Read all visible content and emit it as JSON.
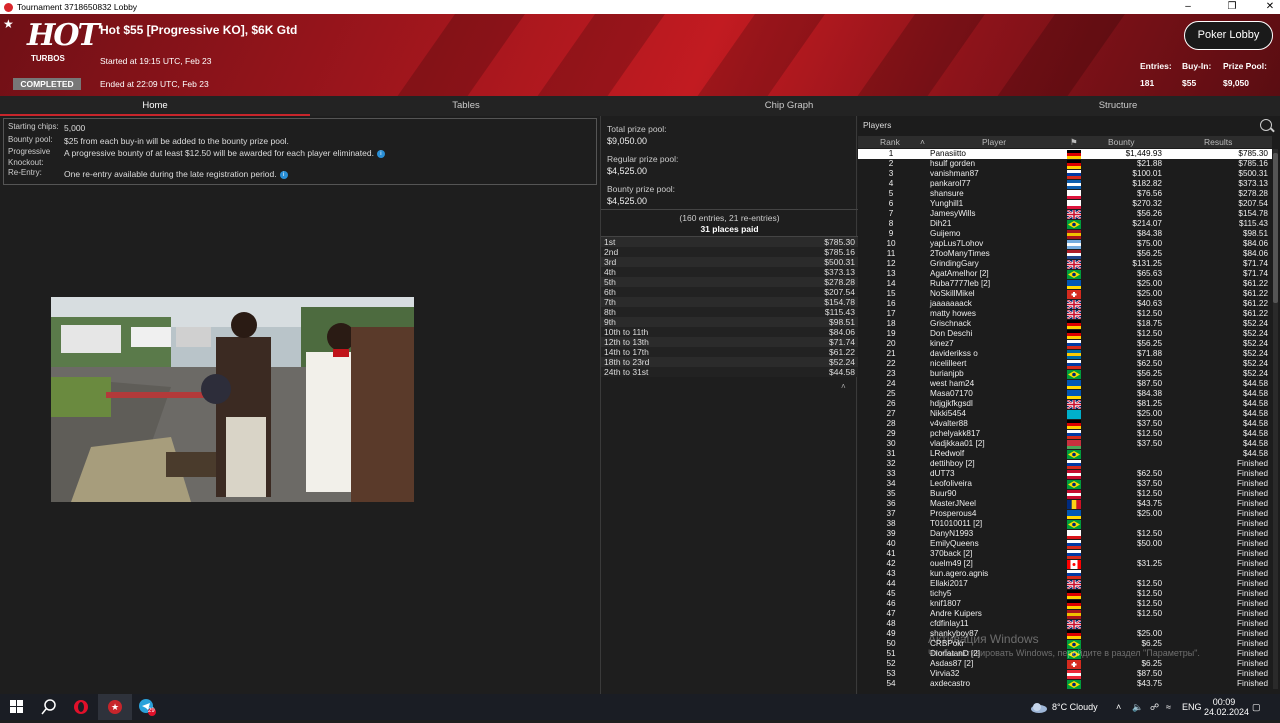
{
  "window": {
    "title": "Tournament 3718650832 Lobby"
  },
  "header": {
    "logo_text": "HOT TURBOS",
    "status_badge": "COMPLETED",
    "tournament_name": "Hot $55 [Progressive KO], $6K Gtd",
    "started": "Started at 19:15 UTC, Feb 23",
    "ended": "Ended at 22:09 UTC, Feb 23",
    "poker_lobby_button": "Poker Lobby",
    "entries_label": "Entries:",
    "entries_value": "181",
    "buyin_label": "Buy-In:",
    "buyin_value": "$55",
    "prizepool_label": "Prize Pool:",
    "prizepool_value": "$9,050"
  },
  "tabs": [
    "Home",
    "Tables",
    "Chip Graph",
    "Structure"
  ],
  "info": [
    {
      "k": "Starting chips:",
      "v": "5,000"
    },
    {
      "k": "Bounty pool:",
      "v": "$25 from each buy-in will be added to the bounty prize pool."
    },
    {
      "k": "Progressive Knockout:",
      "v": "A progressive bounty of at least $12.50 will be awarded for each player eliminated."
    },
    {
      "k": "Re-Entry:",
      "v": "One re-entry available during the late registration period."
    }
  ],
  "prize": {
    "total_label": "Total prize pool:",
    "total_value": "$9,050.00",
    "regular_label": "Regular prize pool:",
    "regular_value": "$4,525.00",
    "bounty_label": "Bounty prize pool:",
    "bounty_value": "$4,525.00",
    "entries_line": "(160 entries, 21 re-entries)",
    "places_paid": "31 places paid",
    "payouts": [
      [
        "1st",
        "$785.30"
      ],
      [
        "2nd",
        "$785.16"
      ],
      [
        "3rd",
        "$500.31"
      ],
      [
        "4th",
        "$373.13"
      ],
      [
        "5th",
        "$278.28"
      ],
      [
        "6th",
        "$207.54"
      ],
      [
        "7th",
        "$154.78"
      ],
      [
        "8th",
        "$115.43"
      ],
      [
        "9th",
        "$98.51"
      ],
      [
        "10th to 11th",
        "$84.06"
      ],
      [
        "12th to 13th",
        "$71.74"
      ],
      [
        "14th to 17th",
        "$61.22"
      ],
      [
        "18th to 23rd",
        "$52.24"
      ],
      [
        "24th to 31st",
        "$44.58"
      ]
    ]
  },
  "players": {
    "title": "Players",
    "columns": [
      "Rank",
      "Player",
      "Bounty",
      "Results"
    ],
    "rows": [
      [
        "1",
        "Panasiitto",
        "$1,449.93",
        "$785.30",
        "de"
      ],
      [
        "2",
        "hsulf gorden",
        "$21.88",
        "$785.16",
        "de"
      ],
      [
        "3",
        "vanishman87",
        "$100.01",
        "$500.31",
        "ru"
      ],
      [
        "4",
        "pankarol77",
        "$182.82",
        "$373.13",
        "gr"
      ],
      [
        "5",
        "shansure",
        "$76.56",
        "$278.28",
        "pl"
      ],
      [
        "6",
        "Yunghill1",
        "$270.32",
        "$207.54",
        "pl"
      ],
      [
        "7",
        "JamesyWills",
        "$56.26",
        "$154.78",
        "gb"
      ],
      [
        "8",
        "Dih21",
        "$214.07",
        "$115.43",
        "br"
      ],
      [
        "9",
        "Guijemo",
        "$84.38",
        "$98.51",
        "es"
      ],
      [
        "10",
        "yapLus7Lohov",
        "$75.00",
        "$84.06",
        "ar"
      ],
      [
        "11",
        "2TooManyTimes",
        "$56.25",
        "$84.06",
        "nl"
      ],
      [
        "12",
        "GrindingGary",
        "$131.25",
        "$71.74",
        "gb"
      ],
      [
        "13",
        "AgatAmelhor [2]",
        "$65.63",
        "$71.74",
        "br"
      ],
      [
        "14",
        "Ruba7777leb [2]",
        "$25.00",
        "$61.22",
        "ua"
      ],
      [
        "15",
        "NoSkillMikel",
        "$25.00",
        "$61.22",
        "ch"
      ],
      [
        "16",
        "jaaaaaaack",
        "$40.63",
        "$61.22",
        "gb"
      ],
      [
        "17",
        "matty howes",
        "$12.50",
        "$61.22",
        "gb"
      ],
      [
        "18",
        "Grischnack",
        "$18.75",
        "$52.24",
        "de"
      ],
      [
        "19",
        "Don Deschi",
        "$12.50",
        "$52.24",
        "de"
      ],
      [
        "20",
        "kinez7",
        "$56.25",
        "$52.24",
        "ru"
      ],
      [
        "21",
        "daviderikss o",
        "$71.88",
        "$52.24",
        "se"
      ],
      [
        "22",
        "nicelilleert",
        "$62.50",
        "$52.24",
        "ru"
      ],
      [
        "23",
        "burianjpb",
        "$56.25",
        "$52.24",
        "br"
      ],
      [
        "24",
        "west ham24",
        "$87.50",
        "$44.58",
        "ua"
      ],
      [
        "25",
        "Masa07170",
        "$84.38",
        "$44.58",
        "ua"
      ],
      [
        "26",
        "hdjgjkfkgsdl",
        "$81.25",
        "$44.58",
        "gb"
      ],
      [
        "27",
        "Nikki5454",
        "$25.00",
        "$44.58",
        "kz"
      ],
      [
        "28",
        "v4valter88",
        "$37.50",
        "$44.58",
        "de"
      ],
      [
        "29",
        "pchelyakk817",
        "$12.50",
        "$44.58",
        "ru"
      ],
      [
        "30",
        "vladjkkaa01 [2]",
        "$37.50",
        "$44.58",
        "by"
      ],
      [
        "31",
        "LRedwolf",
        "",
        "$44.58",
        "br"
      ],
      [
        "32",
        "dettihboy [2]",
        "",
        "Finished",
        "ru"
      ],
      [
        "33",
        "dUT73",
        "$62.50",
        "Finished",
        "dk"
      ],
      [
        "34",
        "Leofoliveira",
        "$37.50",
        "Finished",
        "br"
      ],
      [
        "35",
        "Buur90",
        "$12.50",
        "Finished",
        "dk"
      ],
      [
        "36",
        "MasterJNeel",
        "$43.75",
        "Finished",
        "ro"
      ],
      [
        "37",
        "Prosperous4",
        "$25.00",
        "Finished",
        "ua"
      ],
      [
        "38",
        "T01010011 [2]",
        "",
        "Finished",
        "br"
      ],
      [
        "39",
        "DanyN1993",
        "$12.50",
        "Finished",
        "cz"
      ],
      [
        "40",
        "EmilyQueens",
        "$50.00",
        "Finished",
        "ru"
      ],
      [
        "41",
        "370back [2]",
        "",
        "Finished",
        "ru"
      ],
      [
        "42",
        "ouelm49 [2]",
        "$31.25",
        "Finished",
        "ca"
      ],
      [
        "43",
        "kun.agero.agnis",
        "",
        "Finished",
        "ru"
      ],
      [
        "44",
        "Ellaki2017",
        "$12.50",
        "Finished",
        "gb"
      ],
      [
        "45",
        "tichy5",
        "$12.50",
        "Finished",
        "de"
      ],
      [
        "46",
        "knif1807",
        "$12.50",
        "Finished",
        "de"
      ],
      [
        "47",
        "Andre Kuipers",
        "$12.50",
        "Finished",
        "es"
      ],
      [
        "48",
        "cfdfinlay11",
        "",
        "Finished",
        "gb"
      ],
      [
        "49",
        "shankyboy87",
        "$25.00",
        "Finished",
        "de"
      ],
      [
        "50",
        "CRBPokr",
        "$6.25",
        "Finished",
        "br"
      ],
      [
        "51",
        "DiorlatanD [2]",
        "",
        "Finished",
        "br"
      ],
      [
        "52",
        "Asdas87 [2]",
        "$6.25",
        "Finished",
        "ch"
      ],
      [
        "53",
        "Virvia32",
        "$87.50",
        "Finished",
        "at"
      ],
      [
        "54",
        "axdecastro",
        "$43.75",
        "Finished",
        "br"
      ]
    ]
  },
  "watermark": {
    "line1": "Активация Windows",
    "line2": "Чтобы активировать Windows, перейдите в раздел \"Параметры\"."
  },
  "taskbar": {
    "weather": "8°C Cloudy",
    "lang": "ENG",
    "time": "00:09",
    "date": "24.02.2024",
    "badge": "29"
  }
}
